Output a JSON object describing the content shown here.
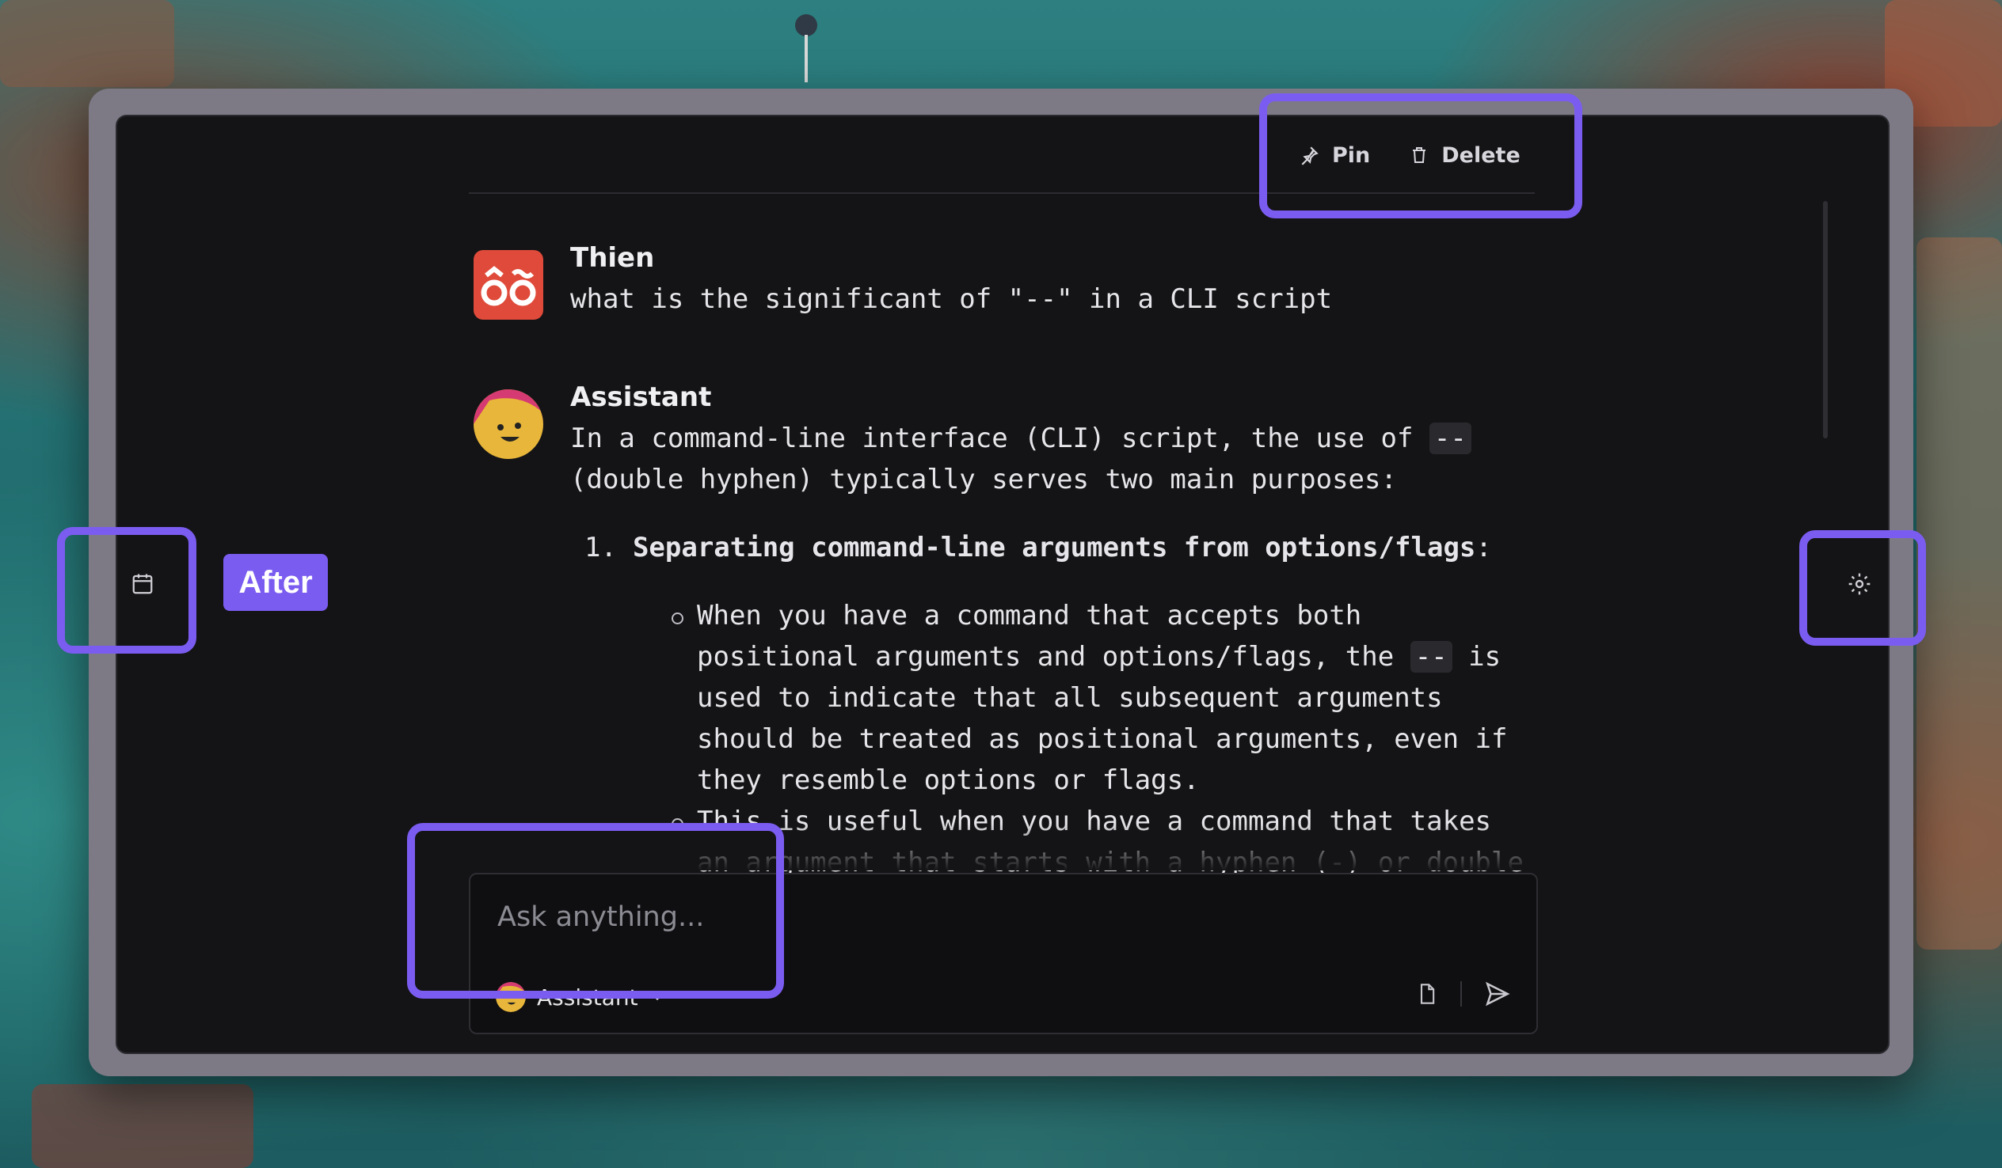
{
  "top_actions": {
    "pin": "Pin",
    "delete": "Delete"
  },
  "messages": [
    {
      "author": "Thien",
      "text": "what is the significant of \"--\" in a CLI script"
    },
    {
      "author": "Assistant",
      "intro_a": "In a command-line interface (CLI) script, the use of",
      "intro_code": "--",
      "intro_b": "(double hyphen) typically serves two main purposes:",
      "list_num": "1.",
      "list_title": "Separating command-line arguments from options/flags",
      "list_colon": ":",
      "bullet1_a": "When you have a command that accepts both positional arguments and options/flags, the",
      "bullet1_code": "--",
      "bullet1_b": "is used to indicate that all subsequent arguments should be treated as positional arguments, even if they resemble options or flags.",
      "bullet2": "This is useful when you have a command that takes an argument that starts with a hyphen (-) or double"
    }
  ],
  "composer": {
    "placeholder": "Ask anything...",
    "model": "Assistant"
  },
  "badge": "After",
  "icons": {
    "left": "calendar-icon",
    "right": "gear-icon",
    "pin": "pin-icon",
    "delete": "trash-icon",
    "attach": "file-icon",
    "send": "send-icon",
    "chevron": "chevron-down-icon"
  },
  "colors": {
    "highlight": "#7b5cf0",
    "panel": "#141416",
    "user_avatar": "#e04a3a",
    "assistant_avatar": "#e8b63a"
  }
}
